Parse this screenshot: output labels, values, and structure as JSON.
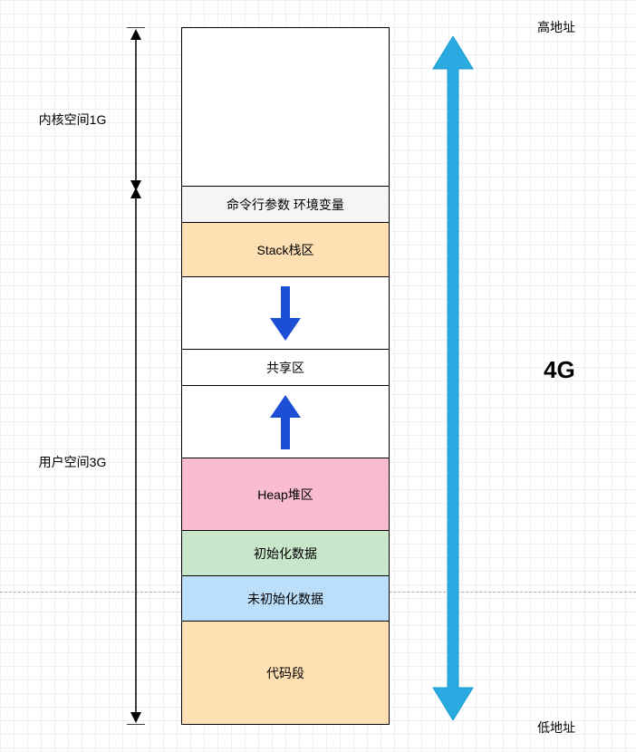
{
  "left": {
    "kernel_label": "内核空间1G",
    "user_label": "用户空间3G"
  },
  "segments": {
    "kernel": "",
    "cmdline": "命令行参数 环境变量",
    "stack": "Stack栈区",
    "shared": "共享区",
    "heap": "Heap堆区",
    "init_data": "初始化数据",
    "uninit_data": "未初始化数据",
    "code": "代码段"
  },
  "right": {
    "high_addr": "高地址",
    "low_addr": "低地址",
    "total": "4G"
  }
}
